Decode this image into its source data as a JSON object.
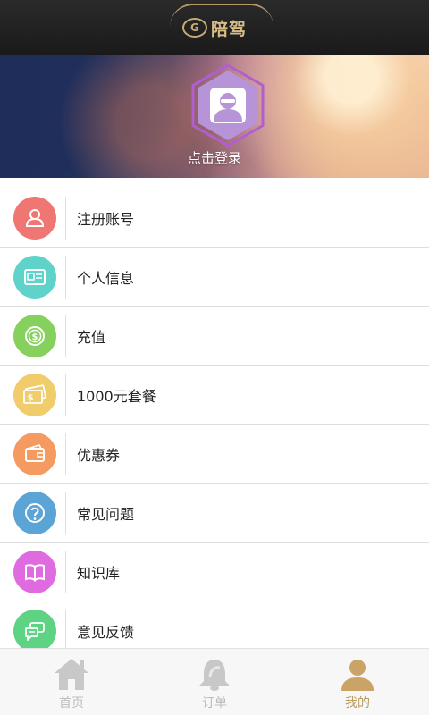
{
  "header": {
    "logo_text": "陪驾",
    "logo_badge": "G"
  },
  "profile": {
    "login_text": "点击登录"
  },
  "menu": {
    "items": [
      {
        "label": "注册账号",
        "icon": "user-icon",
        "color": "#ef7673"
      },
      {
        "label": "个人信息",
        "icon": "id-card-icon",
        "color": "#5fd3c9"
      },
      {
        "label": "充值",
        "icon": "coin-icon",
        "color": "#86d05e"
      },
      {
        "label": "1000元套餐",
        "icon": "cash-icon",
        "color": "#f0cc6a"
      },
      {
        "label": "优惠券",
        "icon": "wallet-icon",
        "color": "#f59b61"
      },
      {
        "label": "常见问题",
        "icon": "question-icon",
        "color": "#5aa4d6"
      },
      {
        "label": "知识库",
        "icon": "book-icon",
        "color": "#e06adf"
      },
      {
        "label": "意见反馈",
        "icon": "chat-icon",
        "color": "#5fd384"
      }
    ]
  },
  "tabbar": {
    "home": "首页",
    "orders": "订单",
    "mine": "我的",
    "active_color": "#b79a5e",
    "inactive_color": "#bdbdbd"
  }
}
